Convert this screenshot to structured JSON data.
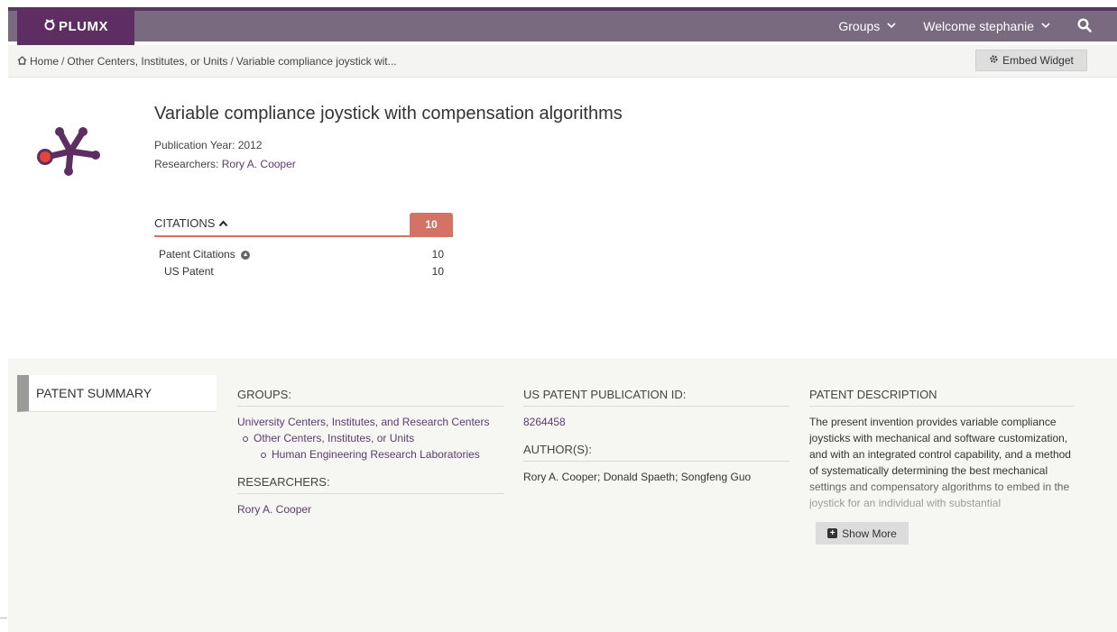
{
  "nav": {
    "logo_text": "PLUMX",
    "groups_label": "Groups",
    "welcome_label": "Welcome stephanie",
    "brand_color": "#5e2d62",
    "bar_color": "#7a6a80"
  },
  "breadcrumb": {
    "home": "Home",
    "sep1": "/",
    "parent": "Other Centers, Institutes, or Units",
    "sep2": "/",
    "current": "Variable compliance joystick wit..."
  },
  "embed_label": "Embed Widget",
  "artifact": {
    "title": "Variable compliance joystick with compensation algorithms",
    "pub_year": "Publication Year: 2012",
    "researchers_prefix": "Researchers:",
    "researcher_name": "Rory A. Cooper"
  },
  "citations": {
    "label": "CITATIONS",
    "total": "10",
    "accent": "#d27366",
    "rows": [
      {
        "label": "Patent Citations",
        "value": "10"
      },
      {
        "label": "US Patent",
        "value": "10"
      }
    ]
  },
  "summary": {
    "tab_label": "PATENT SUMMARY",
    "groups_head": "GROUPS:",
    "group_top": "University Centers, Institutes, and Research Centers",
    "group_sub": "Other Centers, Institutes, or Units",
    "group_subsub": "Human Engineering Research Laboratories",
    "researchers_head": "RESEARCHERS:",
    "researcher": "Rory A. Cooper",
    "pub_id_head": "US PATENT PUBLICATION ID:",
    "pub_id": "8264458",
    "authors_head": "AUTHOR(S):",
    "authors": "Rory A. Cooper; Donald Spaeth; Songfeng Guo",
    "desc_head": "PATENT DESCRIPTION",
    "description": "The present invention provides variable compliance joysticks with mechanical and software customization, and with an integrated control capability, and a method of systematically determining the best mechanical settings and compensatory algorithms to embed in the joystick for an individual with substantial",
    "show_more": "Show More"
  }
}
